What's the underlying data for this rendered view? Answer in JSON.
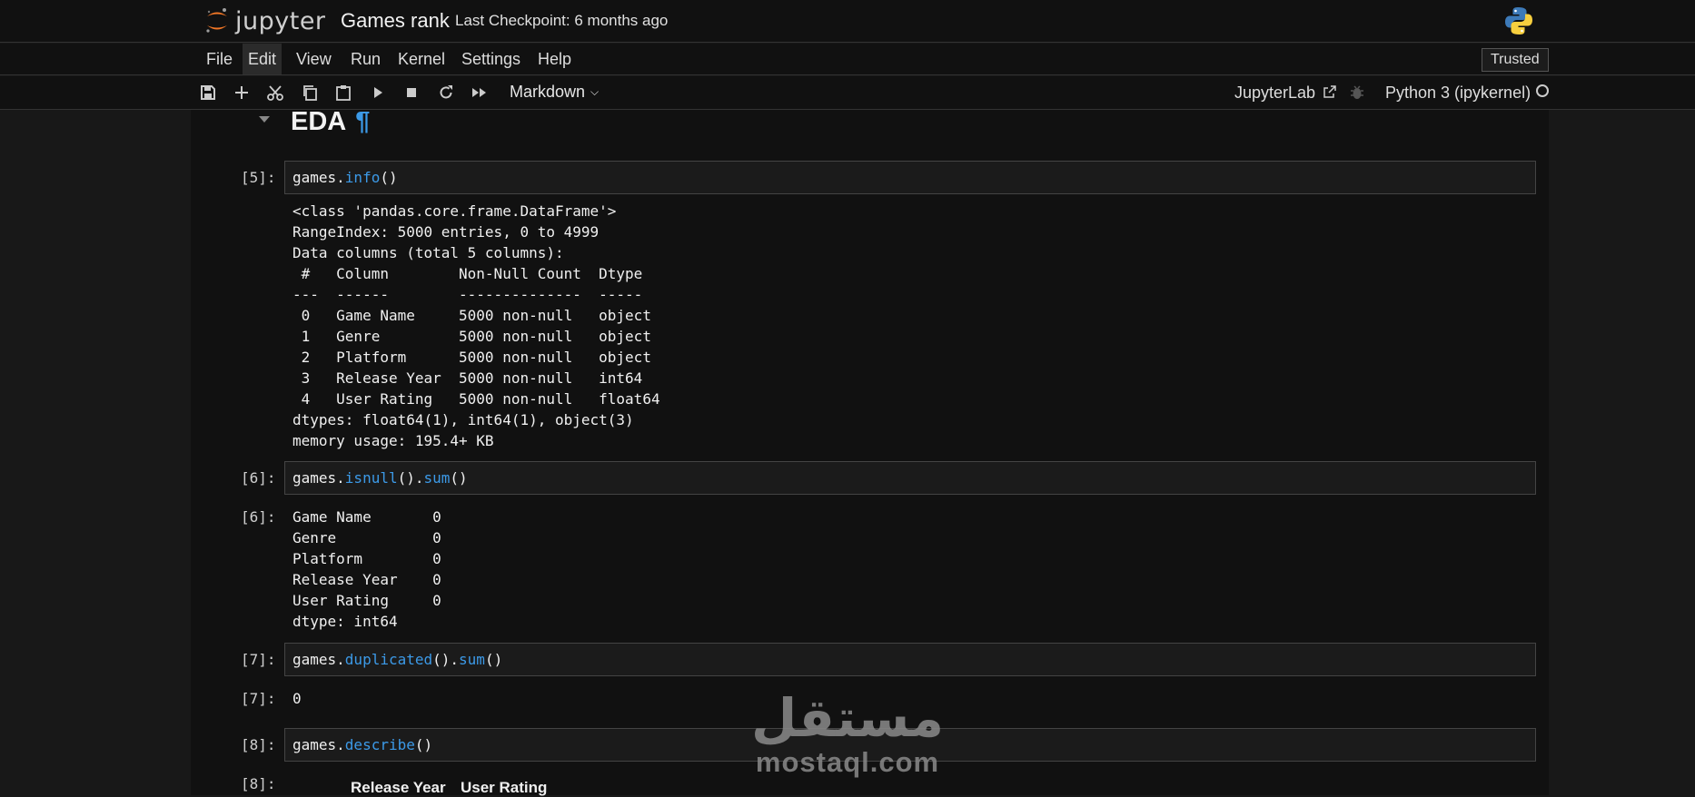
{
  "header": {
    "logo_text": "jupyter",
    "notebook_title": "Games rank",
    "checkpoint": "Last Checkpoint: 6 months ago"
  },
  "menu": {
    "items": [
      "File",
      "Edit",
      "View",
      "Run",
      "Kernel",
      "Settings",
      "Help"
    ],
    "active": "Edit",
    "trusted": "Trusted"
  },
  "toolbar": {
    "cell_type": "Markdown",
    "jupyterlab": "JupyterLab",
    "kernel": "Python 3 (ipykernel)"
  },
  "cells": {
    "heading": {
      "text": "EDA",
      "anchor": "¶"
    },
    "c5": {
      "prompt": "[5]:",
      "obj": "games.",
      "fn": "info",
      "tail": "()",
      "output": "<class 'pandas.core.frame.DataFrame'>\nRangeIndex: 5000 entries, 0 to 4999\nData columns (total 5 columns):\n #   Column        Non-Null Count  Dtype  \n---  ------        --------------  -----  \n 0   Game Name     5000 non-null   object \n 1   Genre         5000 non-null   object \n 2   Platform      5000 non-null   object \n 3   Release Year  5000 non-null   int64  \n 4   User Rating   5000 non-null   float64\ndtypes: float64(1), int64(1), object(3)\nmemory usage: 195.4+ KB"
    },
    "c6": {
      "prompt": "[6]:",
      "obj": "games.",
      "fn1": "isnull",
      "mid": "().",
      "fn2": "sum",
      "tail": "()",
      "out_prompt": "[6]:",
      "output": "Game Name       0\nGenre           0\nPlatform        0\nRelease Year    0\nUser Rating     0\ndtype: int64"
    },
    "c7": {
      "prompt": "[7]:",
      "obj": "games.",
      "fn1": "duplicated",
      "mid": "().",
      "fn2": "sum",
      "tail": "()",
      "out_prompt": "[7]:",
      "output": "0"
    },
    "c8": {
      "prompt": "[8]:",
      "obj": "games.",
      "fn": "describe",
      "tail": "()",
      "out_prompt": "[8]:",
      "col1": "Release Year",
      "col2": "User Rating"
    }
  },
  "watermark": {
    "arabic": "مستقل",
    "latin": "mostaql.com"
  },
  "colors": {
    "accent": "#3c9ae8",
    "background": "#111111",
    "page": "#181818"
  }
}
